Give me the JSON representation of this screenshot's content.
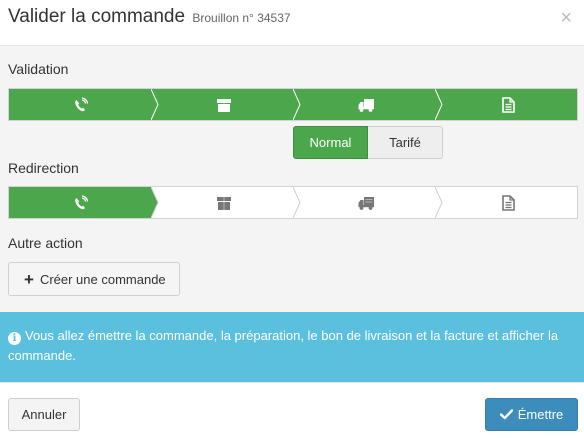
{
  "header": {
    "title": "Valider la commande",
    "subtitle": "Brouillon n° 34537",
    "close_label": "×"
  },
  "validation": {
    "label": "Validation",
    "steps": [
      {
        "icon": "phone-icon",
        "active": true
      },
      {
        "icon": "box-icon",
        "active": true
      },
      {
        "icon": "delivery-truck-icon",
        "active": true
      },
      {
        "icon": "invoice-icon",
        "active": true
      }
    ],
    "options": {
      "normal_label": "Normal",
      "tarife_label": "Tarifé",
      "selected": "Normal"
    }
  },
  "redirection": {
    "label": "Redirection",
    "steps": [
      {
        "icon": "phone-icon",
        "active": true
      },
      {
        "icon": "box-icon",
        "active": false
      },
      {
        "icon": "delivery-truck-icon",
        "active": false
      },
      {
        "icon": "invoice-icon",
        "active": false
      }
    ]
  },
  "other_action": {
    "label": "Autre action",
    "create_label": "Créer une commande",
    "create_icon": "plus-icon"
  },
  "info": {
    "icon": "info-icon",
    "icon_glyph": "i",
    "text": "Vous allez émettre la commande, la préparation, le bon de livraison et la facture et afficher la commande."
  },
  "footer": {
    "cancel_label": "Annuler",
    "submit_label": "Émettre",
    "submit_icon": "check-icon"
  },
  "colors": {
    "active_step": "#4ca64c",
    "info_bg": "#5bc0de",
    "primary": "#3c8dbc",
    "inactive_icon": "#777777"
  }
}
